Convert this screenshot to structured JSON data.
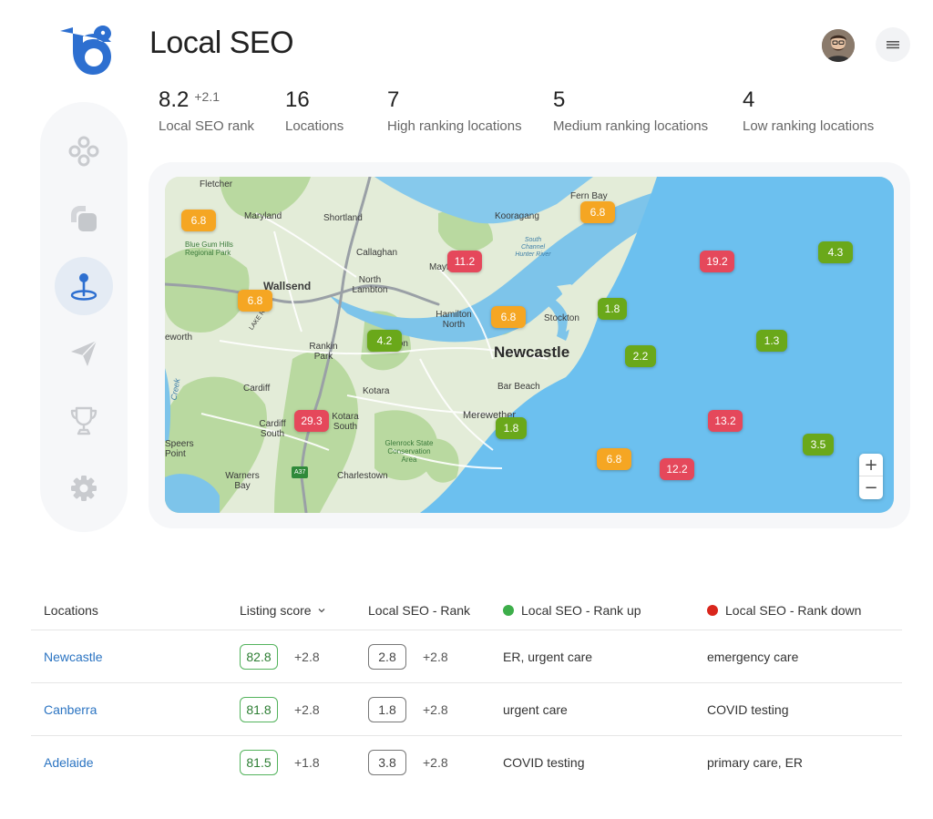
{
  "page": {
    "title": "Local SEO"
  },
  "stats": [
    {
      "value": "8.2",
      "delta": "+2.1",
      "label": "Local SEO rank"
    },
    {
      "value": "16",
      "delta": "",
      "label": "Locations"
    },
    {
      "value": "7",
      "delta": "",
      "label": "High ranking locations"
    },
    {
      "value": "5",
      "delta": "",
      "label": "Medium ranking locations"
    },
    {
      "value": "4",
      "delta": "",
      "label": "Low ranking locations"
    }
  ],
  "sidebar": {
    "items": [
      {
        "icon": "dashboard-icon",
        "active": false
      },
      {
        "icon": "layers-icon",
        "active": false
      },
      {
        "icon": "map-pin-icon",
        "active": true
      },
      {
        "icon": "send-icon",
        "active": false
      },
      {
        "icon": "trophy-icon",
        "active": false
      },
      {
        "icon": "gear-icon",
        "active": false
      }
    ]
  },
  "map": {
    "places": {
      "fletcher": "Fletcher",
      "maryland": "Maryland",
      "shortland": "Shortland",
      "kooragang": "Kooragang",
      "fern_bay": "Fern Bay",
      "south_channel": "South Channel Hunter River",
      "blue_gum": "Blue Gum Hills Regional Park",
      "callaghan": "Callaghan",
      "mayfield": "Mayf",
      "wallsend": "Wallsend",
      "north_lambton": "North Lambton",
      "lake_rd": "LAKE RD",
      "hamilton_north": "Hamilton North",
      "stockton": "Stockton",
      "edgeworth": "eworth",
      "rankin_park": "Rankin Park",
      "lambton": "ton",
      "newcastle": "Newcastle",
      "bar_beach": "Bar Beach",
      "cardiff": "Cardiff",
      "kotara": "Kotara",
      "merewether": "Merewether",
      "cardiff_south": "Cardiff South",
      "kotara_south": "Kotara South",
      "glenrock": "Glenrock State Conservation Area",
      "speers_point": "Speers Point",
      "warners_bay": "Warners Bay",
      "charlestown": "Charlestown",
      "a37": "A37",
      "creek": "Creek"
    },
    "markers": [
      {
        "value": "6.8",
        "level": "medium"
      },
      {
        "value": "6.8",
        "level": "medium"
      },
      {
        "value": "11.2",
        "level": "low"
      },
      {
        "value": "19.2",
        "level": "low"
      },
      {
        "value": "4.3",
        "level": "high"
      },
      {
        "value": "6.8",
        "level": "medium"
      },
      {
        "value": "1.8",
        "level": "high"
      },
      {
        "value": "6.8",
        "level": "medium"
      },
      {
        "value": "4.2",
        "level": "high"
      },
      {
        "value": "2.2",
        "level": "high"
      },
      {
        "value": "1.3",
        "level": "high"
      },
      {
        "value": "29.3",
        "level": "low"
      },
      {
        "value": "1.8",
        "level": "high"
      },
      {
        "value": "13.2",
        "level": "low"
      },
      {
        "value": "3.5",
        "level": "high"
      },
      {
        "value": "6.8",
        "level": "medium"
      },
      {
        "value": "12.2",
        "level": "low"
      }
    ],
    "zoom_in": "+",
    "zoom_out": "−"
  },
  "table": {
    "headers": {
      "locations": "Locations",
      "listing_score": "Listing score",
      "local_seo_rank": "Local SEO - Rank",
      "rank_up": "Local SEO - Rank up",
      "rank_down": "Local SEO - Rank down"
    },
    "rows": [
      {
        "location": "Newcastle",
        "listing_score": "82.8",
        "listing_delta": "+2.8",
        "rank": "2.8",
        "rank_delta": "+2.8",
        "rank_up": "ER, urgent care",
        "rank_down": "emergency care"
      },
      {
        "location": "Canberra",
        "listing_score": "81.8",
        "listing_delta": "+2.8",
        "rank": "1.8",
        "rank_delta": "+2.8",
        "rank_up": "urgent care",
        "rank_down": "COVID testing"
      },
      {
        "location": "Adelaide",
        "listing_score": "81.5",
        "listing_delta": "+1.8",
        "rank": "3.8",
        "rank_delta": "+2.8",
        "rank_up": "COVID testing",
        "rank_down": "primary care, ER"
      }
    ]
  },
  "colors": {
    "high": "#6aa81a",
    "medium": "#f5a623",
    "low": "#e5485b",
    "brand": "#2d6fd0",
    "rank_up_dot": "#3dae4a",
    "rank_down_dot": "#d9261c"
  }
}
